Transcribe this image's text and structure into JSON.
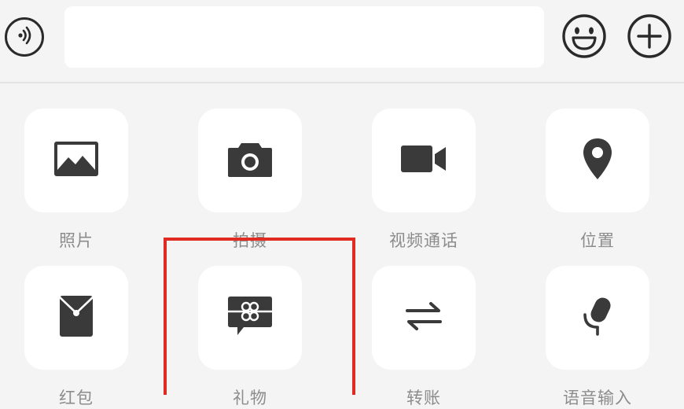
{
  "input_bar": {
    "voice_icon": "voice-icon",
    "text_value": "",
    "emoji_icon": "smile-emoji-icon",
    "plus_icon": "plus-circle-icon"
  },
  "panel": {
    "items": [
      {
        "label": "照片",
        "icon": "photo-icon"
      },
      {
        "label": "拍摄",
        "icon": "camera-icon"
      },
      {
        "label": "视频通话",
        "icon": "video-call-icon"
      },
      {
        "label": "位置",
        "icon": "location-pin-icon"
      },
      {
        "label": "红包",
        "icon": "red-packet-icon"
      },
      {
        "label": "礼物",
        "icon": "gift-icon"
      },
      {
        "label": "转账",
        "icon": "transfer-icon"
      },
      {
        "label": "语音输入",
        "icon": "voice-input-icon"
      }
    ]
  },
  "colors": {
    "background": "#f4f4f4",
    "tile": "#ffffff",
    "icon": "#3a3a3a",
    "label": "#8c8c8c",
    "highlight": "#e02a22"
  }
}
